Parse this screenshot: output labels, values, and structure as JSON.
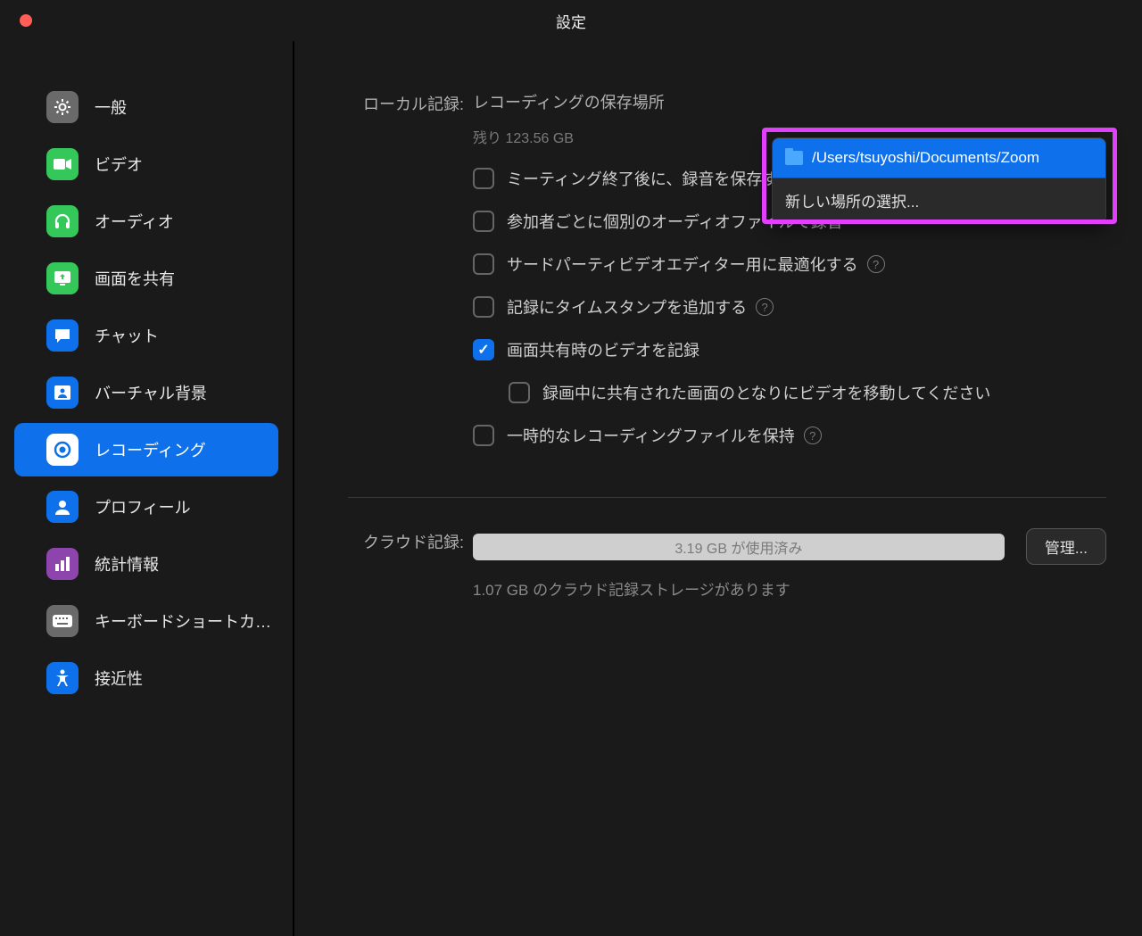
{
  "window": {
    "title": "設定"
  },
  "sidebar": {
    "items": [
      {
        "label": "一般"
      },
      {
        "label": "ビデオ"
      },
      {
        "label": "オーディオ"
      },
      {
        "label": "画面を共有"
      },
      {
        "label": "チャット"
      },
      {
        "label": "バーチャル背景"
      },
      {
        "label": "レコーディング"
      },
      {
        "label": "プロフィール"
      },
      {
        "label": "統計情報"
      },
      {
        "label": "キーボードショートカ…"
      },
      {
        "label": "接近性"
      }
    ]
  },
  "local": {
    "section_label": "ローカル記録:",
    "location_label": "レコーディングの保存場所",
    "remaining": "残り 123.56 GB",
    "options": [
      {
        "label": "ミーティング終了後に、録音を保存する場所を選択",
        "checked": false
      },
      {
        "label": "参加者ごとに個別のオーディオファイルで録音",
        "checked": false
      },
      {
        "label": "サードパーティビデオエディター用に最適化する",
        "checked": false,
        "help": true
      },
      {
        "label": "記録にタイムスタンプを追加する",
        "checked": false,
        "help": true
      },
      {
        "label": "画面共有時のビデオを記録",
        "checked": true
      },
      {
        "label": "録画中に共有された画面のとなりにビデオを移動してください",
        "checked": false,
        "indent": true
      },
      {
        "label": "一時的なレコーディングファイルを保持",
        "checked": false,
        "help": true
      }
    ]
  },
  "cloud": {
    "section_label": "クラウド記録:",
    "used": "3.19 GB が使用済み",
    "note": "1.07 GB のクラウド記録ストレージがあります",
    "manage": "管理..."
  },
  "dropdown": {
    "path": "/Users/tsuyoshi/Documents/Zoom",
    "new_location": "新しい場所の選択..."
  }
}
